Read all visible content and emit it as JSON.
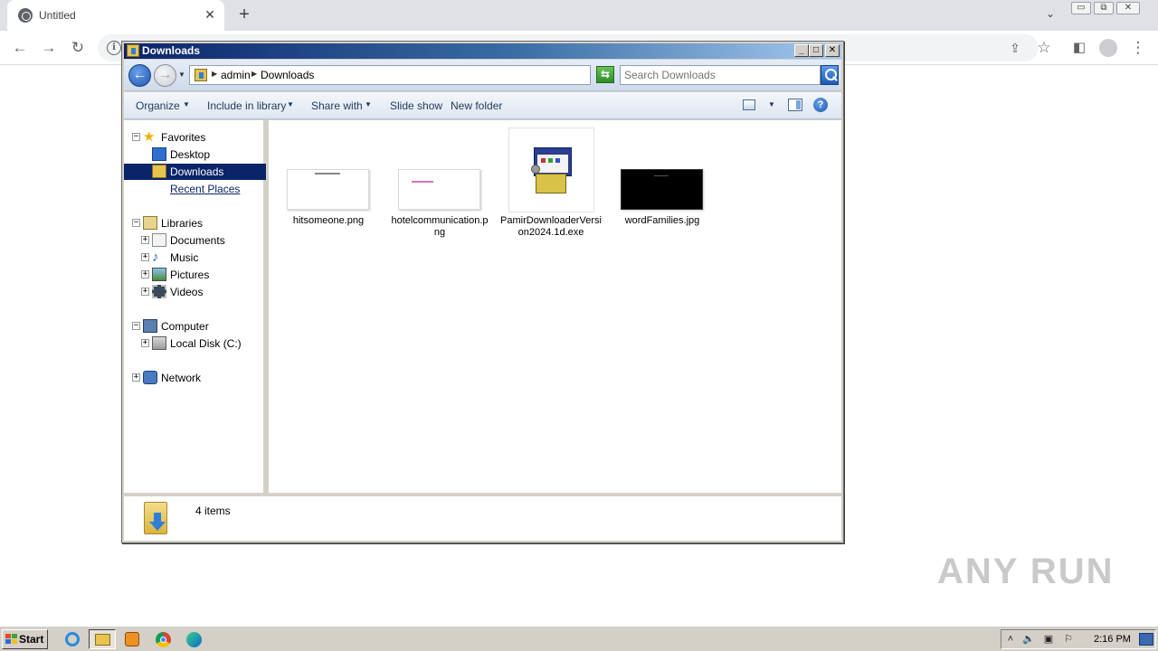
{
  "browser": {
    "tab_title": "Untitled",
    "tab_close": "✕",
    "new_tab": "+"
  },
  "explorer": {
    "title": "Downloads",
    "breadcrumb": [
      "admin",
      "Downloads"
    ],
    "search_placeholder": "Search Downloads",
    "commands": {
      "organize": "Organize",
      "include_in_library": "Include in library",
      "share_with": "Share with",
      "slide_show": "Slide show",
      "new_folder": "New folder"
    },
    "nav": {
      "favorites": "Favorites",
      "desktop": "Desktop",
      "downloads": "Downloads",
      "recent_places": "Recent Places",
      "libraries": "Libraries",
      "documents": "Documents",
      "music": "Music",
      "pictures": "Pictures",
      "videos": "Videos",
      "computer": "Computer",
      "local_disk": "Local Disk (C:)",
      "network": "Network"
    },
    "files": [
      {
        "name": "hitsomeone.png",
        "type": "png-thumb"
      },
      {
        "name": "hotelcommunication.png",
        "type": "png-thumb"
      },
      {
        "name": "PamirDownloaderVersion2024.1d.exe",
        "type": "installer-icon"
      },
      {
        "name": "wordFamilies.jpg",
        "type": "jpg-thumb"
      }
    ],
    "status": {
      "item_count": "4 items"
    }
  },
  "watermark": "ANY RUN",
  "taskbar": {
    "start": "Start",
    "clock": "2:16 PM",
    "programs": [
      "internet-explorer-icon",
      "explorer-folder-icon",
      "media-player-icon",
      "chrome-icon",
      "edge-icon"
    ]
  }
}
